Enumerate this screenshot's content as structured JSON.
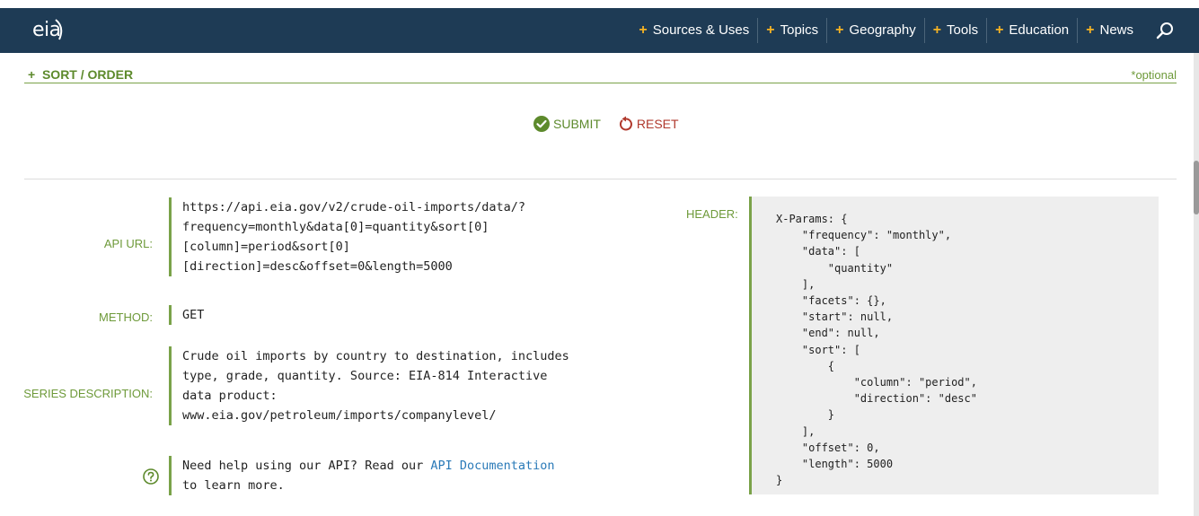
{
  "brand": {
    "logo_text": "eia"
  },
  "nav": {
    "items": [
      {
        "label": "Sources & Uses"
      },
      {
        "label": "Topics"
      },
      {
        "label": "Geography"
      },
      {
        "label": "Tools"
      },
      {
        "label": "Education"
      },
      {
        "label": "News"
      }
    ],
    "plus_symbol": "+"
  },
  "sort": {
    "label": "SORT / ORDER",
    "optional": "*optional",
    "plus_symbol": "+"
  },
  "actions": {
    "submit": "SUBMIT",
    "reset": "RESET"
  },
  "api": {
    "url_label": "API URL:",
    "url_lines": [
      "https://api.eia.gov/v2/crude-oil-imports/data/?",
      "frequency=monthly&data[0]=quantity&sort[0]",
      "[column]=period&sort[0]",
      "[direction]=desc&offset=0&length=5000"
    ],
    "method_label": "METHOD:",
    "method_value": "GET",
    "description_label": "SERIES DESCRIPTION:",
    "description_lines": [
      "Crude oil imports by country to destination, includes",
      "type, grade, quantity. Source: EIA-814 Interactive",
      "data product:",
      "www.eia.gov/petroleum/imports/companylevel/"
    ],
    "help_prefix": "Need help using our API? Read our ",
    "help_link": "API Documentation",
    "help_suffix": "to learn more."
  },
  "header": {
    "label": "HEADER:",
    "code": "X-Params: {\n    \"frequency\": \"monthly\",\n    \"data\": [\n        \"quantity\"\n    ],\n    \"facets\": {},\n    \"start\": null,\n    \"end\": null,\n    \"sort\": [\n        {\n            \"column\": \"period\",\n            \"direction\": \"desc\"\n        }\n    ],\n    \"offset\": 0,\n    \"length\": 5000\n}"
  },
  "colors": {
    "nav_bg": "#1e3b55",
    "accent_green": "#7aa249",
    "plus_gold": "#f5b324",
    "reset_red": "#b0392d",
    "link_blue": "#2a7ab8"
  }
}
